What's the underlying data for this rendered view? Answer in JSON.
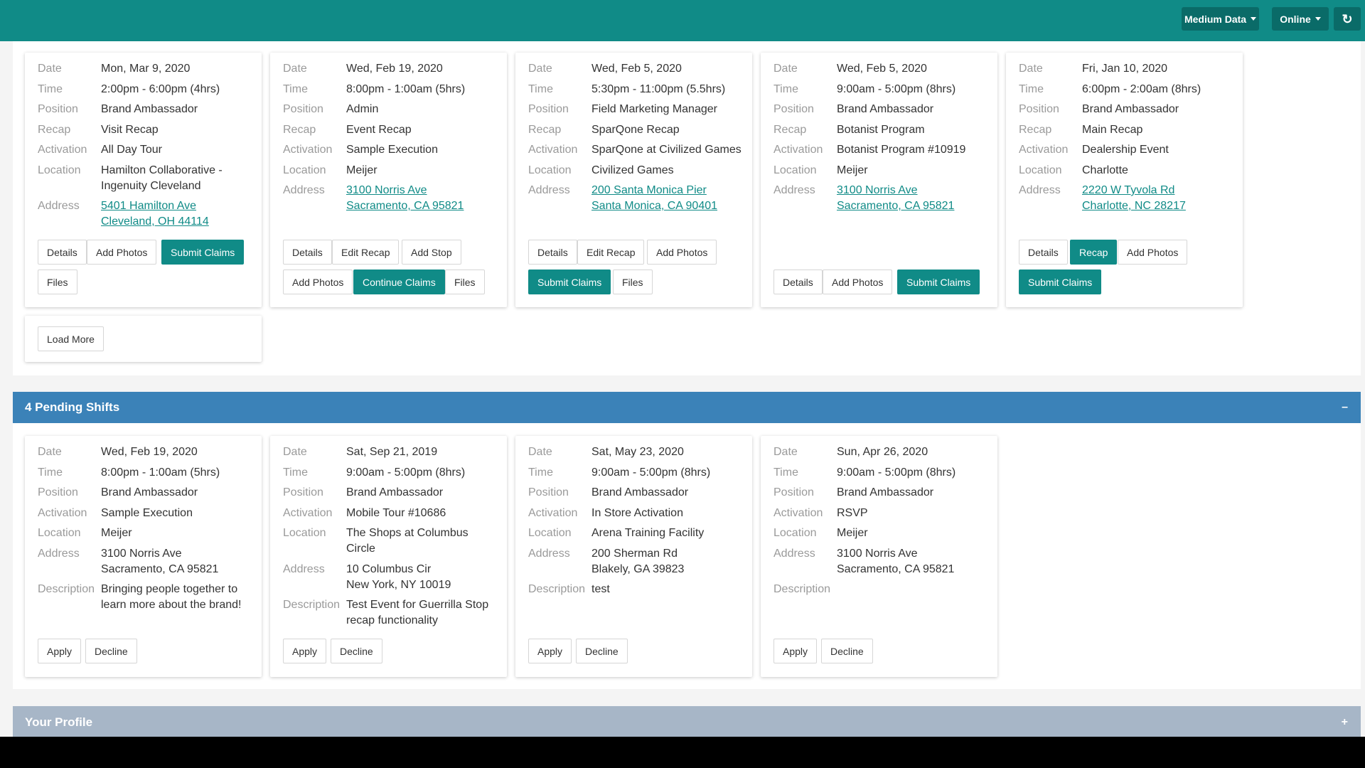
{
  "topbar": {
    "data_button": "Medium Data",
    "status_button": "Online",
    "refresh_icon": "refresh-icon"
  },
  "labels": {
    "date": "Date",
    "time": "Time",
    "position": "Position",
    "recap": "Recap",
    "activation": "Activation",
    "location": "Location",
    "address": "Address",
    "description": "Description"
  },
  "shifts": {
    "cards": [
      {
        "date": "Mon, Mar 9, 2020",
        "time": "2:00pm - 6:00pm (4hrs)",
        "position": "Brand Ambassador",
        "recap": "Visit Recap",
        "activation": "All Day Tour",
        "location": "Hamilton Collaborative - Ingenuity Cleveland",
        "address": "5401 Hamilton Ave\nCleveland, OH 44114",
        "buttons": [
          "Details",
          "Add Photos",
          "Submit Claims",
          "Files"
        ]
      },
      {
        "date": "Wed, Feb 19, 2020",
        "time": "8:00pm - 1:00am (5hrs)",
        "position": "Admin",
        "recap": "Event Recap",
        "activation": "Sample Execution",
        "location": "Meijer",
        "address": "3100 Norris Ave\nSacramento, CA 95821",
        "buttons": [
          "Details",
          "Edit Recap",
          "Add Stop",
          "Add Photos",
          "Continue Claims",
          "Files"
        ]
      },
      {
        "date": "Wed, Feb 5, 2020",
        "time": "5:30pm - 11:00pm (5.5hrs)",
        "position": "Field Marketing Manager",
        "recap": "SparQone Recap",
        "activation": "SparQone at Civilized Games",
        "location": "Civilized Games",
        "address": "200 Santa Monica Pier\nSanta Monica, CA 90401",
        "buttons": [
          "Details",
          "Edit Recap",
          "Add Photos",
          "Submit Claims",
          "Files"
        ]
      },
      {
        "date": "Wed, Feb 5, 2020",
        "time": "9:00am - 5:00pm (8hrs)",
        "position": "Brand Ambassador",
        "recap": "Botanist Program",
        "activation": "Botanist Program #10919",
        "location": "Meijer",
        "address": "3100 Norris Ave\nSacramento, CA 95821",
        "buttons": [
          "Details",
          "Add Photos",
          "Submit Claims"
        ]
      },
      {
        "date": "Fri, Jan 10, 2020",
        "time": "6:00pm - 2:00am (8hrs)",
        "position": "Brand Ambassador",
        "recap": "Main Recap",
        "activation": "Dealership Event",
        "location": "Charlotte",
        "address": "2220 W Tyvola Rd\nCharlotte, NC 28217",
        "buttons": [
          "Details",
          "Recap",
          "Add Photos",
          "Submit Claims"
        ]
      }
    ],
    "load_more": "Load More"
  },
  "pending": {
    "title": "4 Pending Shifts",
    "toggle": "–",
    "cards": [
      {
        "date": "Wed, Feb 19, 2020",
        "time": "8:00pm - 1:00am (5hrs)",
        "position": "Brand Ambassador",
        "activation": "Sample Execution",
        "location": "Meijer",
        "address": "3100 Norris Ave\nSacramento, CA 95821",
        "description": "Bringing people together to learn more about the brand!"
      },
      {
        "date": "Sat, Sep 21, 2019",
        "time": "9:00am - 5:00pm (8hrs)",
        "position": "Brand Ambassador",
        "activation": "Mobile Tour #10686",
        "location": "The Shops at Columbus Circle",
        "address": "10 Columbus Cir\nNew York, NY 10019",
        "description": "Test Event for Guerrilla Stop recap functionality"
      },
      {
        "date": "Sat, May 23, 2020",
        "time": "9:00am - 5:00pm (8hrs)",
        "position": "Brand Ambassador",
        "activation": "In Store Activation",
        "location": "Arena Training Facility",
        "address": "200 Sherman Rd\nBlakely, GA 39823",
        "description": "test"
      },
      {
        "date": "Sun, Apr 26, 2020",
        "time": "9:00am - 5:00pm (8hrs)",
        "position": "Brand Ambassador",
        "activation": "RSVP",
        "location": "Meijer",
        "address": "3100 Norris Ave\nSacramento, CA 95821",
        "description": ""
      }
    ],
    "apply": "Apply",
    "decline": "Decline"
  },
  "profile": {
    "title": "Your Profile",
    "toggle": "+"
  },
  "colors": {
    "teal": "#108b87",
    "teal_dark": "#0a6b68",
    "pending_blue": "#3b82b8",
    "profile_gray": "#a7b6c7"
  }
}
